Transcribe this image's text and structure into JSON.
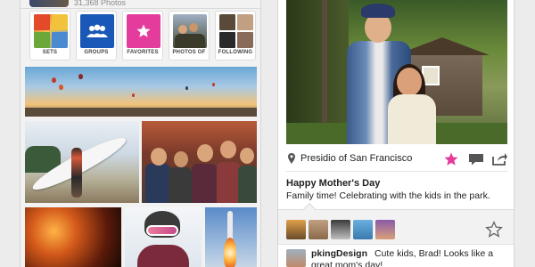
{
  "left": {
    "photo_count": "31,368 Photos",
    "shortcuts": [
      {
        "label": "SETS"
      },
      {
        "label": "GROUPS"
      },
      {
        "label": "FAVORITES"
      },
      {
        "label": "PHOTOS OF"
      },
      {
        "label": "FOLLOWING"
      }
    ]
  },
  "right": {
    "location": "Presidio of San Francisco",
    "caption_title": "Happy Mother's Day",
    "caption_text": "Family time! Celebrating with the kids in the park.",
    "comment": {
      "user": "pkingDesign",
      "text_line1": "Cute kids, Brad! Looks like a",
      "text_line2": "great mom's day!"
    }
  },
  "colors": {
    "favorite_pink": "#e33c9c",
    "groups_blue": "#1a58b8"
  }
}
